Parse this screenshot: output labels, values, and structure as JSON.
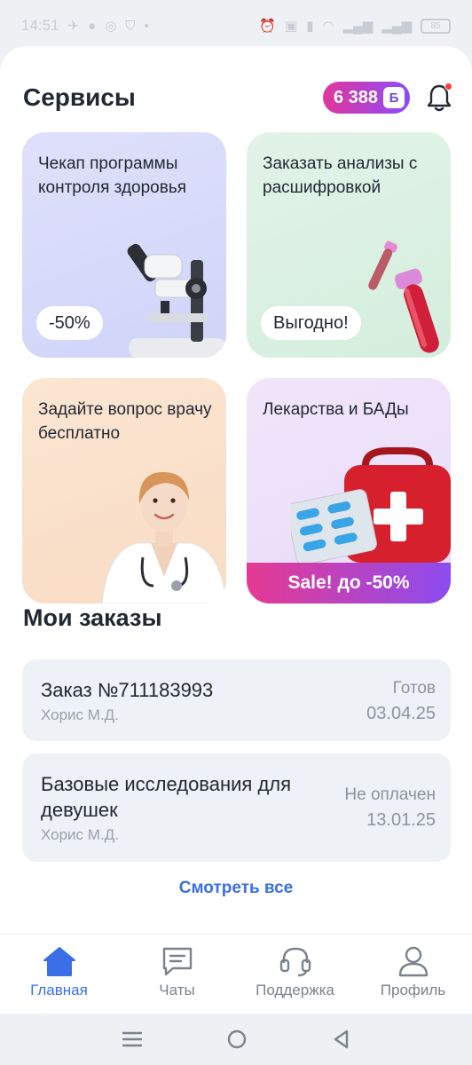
{
  "status_bar": {
    "time": "14:51",
    "battery": "85"
  },
  "header": {
    "title": "Сервисы",
    "points": "6 388",
    "points_unit": "Б"
  },
  "services": [
    {
      "title": "Чекап программы контроля здоровья",
      "badge": "-50%",
      "icon": "microscope"
    },
    {
      "title": "Заказать анализы с расшифровкой",
      "badge": "Выгодно!",
      "icon": "test-tubes"
    },
    {
      "title": "Задайте вопрос врачу бесплатно",
      "icon": "doctor"
    },
    {
      "title": "Лекарства и БАДы",
      "badge": "Sale! до -50%",
      "icon": "first-aid-kit"
    }
  ],
  "orders": {
    "title": "Мои заказы",
    "items": [
      {
        "name": "Заказ №711183993",
        "doctor": "Хорис М.Д.",
        "status": "Готов",
        "date": "03.04.25"
      },
      {
        "name": "Базовые исследования для девушек",
        "doctor": "Хорис М.Д.",
        "status": "Не оплачен",
        "date": "13.01.25"
      }
    ],
    "see_all": "Смотреть все"
  },
  "nav": [
    {
      "label": "Главная",
      "icon": "home",
      "active": true
    },
    {
      "label": "Чаты",
      "icon": "chat"
    },
    {
      "label": "Поддержка",
      "icon": "headset"
    },
    {
      "label": "Профиль",
      "icon": "profile"
    }
  ],
  "colors": {
    "accent": "#3a6fe8",
    "badge_start": "#e0369a",
    "badge_end": "#8b4cff"
  }
}
